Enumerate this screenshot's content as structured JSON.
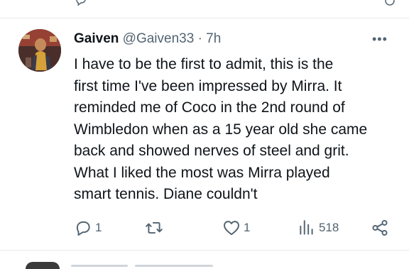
{
  "tweet": {
    "author_name": "Gaiven",
    "author_handle": "@Gaiven33",
    "separator": "·",
    "time": "7h",
    "more_label": "•••",
    "text_lines": [
      "I have to be the first to admit, this is the",
      "first time I've been impressed by Mirra. It",
      "reminded me of Coco in the 2nd round of",
      "Wimbledon when as a 15 year old she came",
      "back and showed nerves of steel and grit.",
      "What I liked the most was Mirra played",
      "smart tennis. Diane couldn't"
    ],
    "actions": {
      "reply_count": "1",
      "retweet_count": "",
      "like_count": "1",
      "views_count": "518"
    }
  },
  "icons": {
    "reply": "reply-icon",
    "retweet": "retweet-icon",
    "like": "heart-icon",
    "views": "views-icon",
    "share": "share-icon",
    "more": "more-icon"
  },
  "colors": {
    "text": "#0f1419",
    "secondary": "#536471",
    "divider": "#e7e9ea"
  }
}
